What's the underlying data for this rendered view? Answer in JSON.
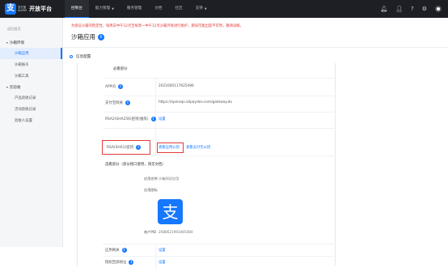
{
  "topbar": {
    "logo_mark": "支",
    "logo_sub_cn": "支付宝",
    "logo_sub_en": "ALIPAY",
    "title": "开放平台",
    "nav": [
      {
        "label": "控制台",
        "active": true,
        "caret": false
      },
      {
        "label": "能力管理",
        "active": false,
        "caret": true
      },
      {
        "label": "服务管理",
        "active": false,
        "caret": false
      },
      {
        "label": "文档",
        "active": false,
        "caret": false
      },
      {
        "label": "社区",
        "active": false,
        "caret": false
      },
      {
        "label": "支持",
        "active": false,
        "caret": true
      }
    ],
    "icons": [
      "bell-icon",
      "user-icon",
      "help-icon",
      "settings-icon"
    ]
  },
  "sidebar": {
    "back_label": "返回首页",
    "groups": [
      {
        "label": "沙箱环境",
        "items": [
          {
            "label": "沙箱应用",
            "active": true
          },
          {
            "label": "沙箱账号",
            "active": false
          },
          {
            "label": "沙箱工具",
            "active": false
          }
        ]
      },
      {
        "label": "云验收",
        "items": [
          {
            "label": "产品验收记录",
            "active": false
          },
          {
            "label": "活动验收记录",
            "active": false
          },
          {
            "label": "验收人设置",
            "active": false
          }
        ]
      }
    ]
  },
  "main": {
    "notice": "为保证沙箱的稳定性，每周日中午12点至每周一中午12点沙箱环境进行维护，期间可能出现不可用，敬请谅解。",
    "page_title": "沙箱应用",
    "section_title": "信息配置",
    "required_title": "必看部分",
    "rows": [
      {
        "label": "APPID",
        "value": "2021000117625496"
      },
      {
        "label": "支付宝网关",
        "value": "https://openapi.alipaydev.com/gateway.do"
      },
      {
        "label": "RSA2(SHA256)密钥(推荐)",
        "value": "设置"
      },
      {
        "label": "RSA(SHA1)密钥",
        "link1": "查看应用公钥",
        "link2": "查看支付宝公钥"
      }
    ],
    "optional_title": "选看部分（部分接口使用，请见文档）",
    "app_name_label": "应用名称",
    "app_name_value": "沙箱测试应用",
    "app_icon_label": "应用图标",
    "app_icon_glyph": "支",
    "pid_label": "商户PID",
    "pid_value": "2088621993465480",
    "bottom_rows": [
      {
        "label": "应用网关",
        "value": "设置"
      },
      {
        "label": "授权回调地址",
        "value": "设置"
      }
    ]
  },
  "colors": {
    "accent": "#1677ff",
    "warning": "#e23b3b",
    "topbar": "#1d1f24"
  }
}
